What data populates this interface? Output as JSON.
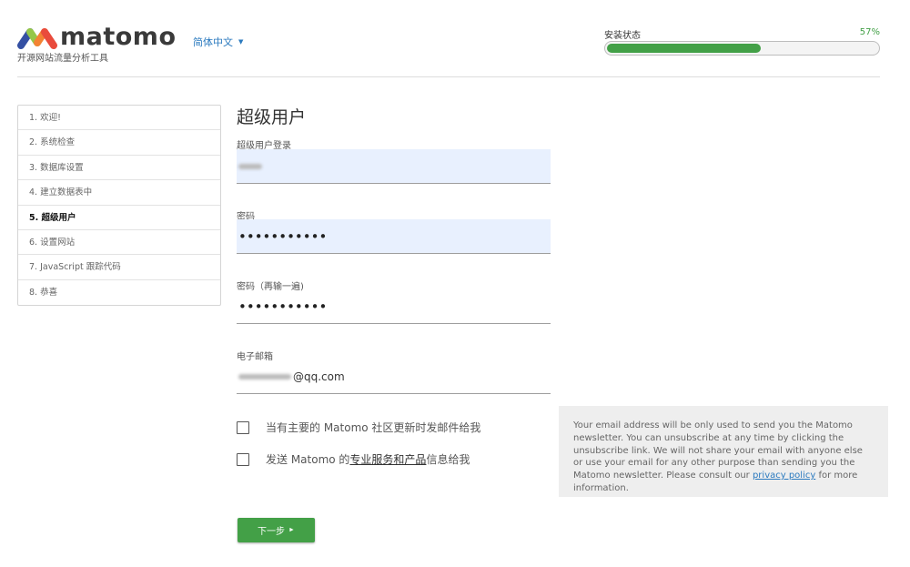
{
  "header": {
    "brand": "matomo",
    "tagline": "开源网站流量分析工具",
    "language": "简体中文",
    "progress_label": "安装状态",
    "progress_value_text": "57%",
    "progress_fraction": 0.57
  },
  "steps": [
    {
      "label": "1. 欢迎!"
    },
    {
      "label": "2. 系统检查"
    },
    {
      "label": "3. 数据库设置"
    },
    {
      "label": "4. 建立数据表中"
    },
    {
      "label": "5. 超级用户",
      "active": true
    },
    {
      "label": "6. 设置网站"
    },
    {
      "label": "7. JavaScript 跟踪代码"
    },
    {
      "label": "8. 恭喜"
    }
  ],
  "form": {
    "title": "超级用户",
    "login_label": "超级用户登录",
    "login_value": "",
    "password_label": "密码",
    "password_value": "•••••••••••",
    "password_repeat_label": "密码（再输一遍)",
    "password_repeat_value": "•••••••••••",
    "email_label": "电子邮箱",
    "email_value_suffix": "@qq.com",
    "checkbox_newsletter_label": "当有主要的 Matomo 社区更新时发邮件给我",
    "checkbox_services_prefix": "发送 Matomo 的",
    "checkbox_services_link": "专业服务和产品",
    "checkbox_services_suffix": " 信息给我",
    "next_label": "下一步"
  },
  "notice": {
    "text": "Your email address will be only used to send you the Matomo newsletter. You can unsubscribe at any time by clicking the unsubscribe link. We will not share your email with anyone else or use your email for any other purpose than sending you the Matomo newsletter. Please consult our ",
    "link": "privacy policy",
    "suffix": " for more information."
  },
  "colors": {
    "accent_green": "#43a047",
    "link_blue": "#2b7abf",
    "autofill_blue": "#e8f0fe"
  }
}
